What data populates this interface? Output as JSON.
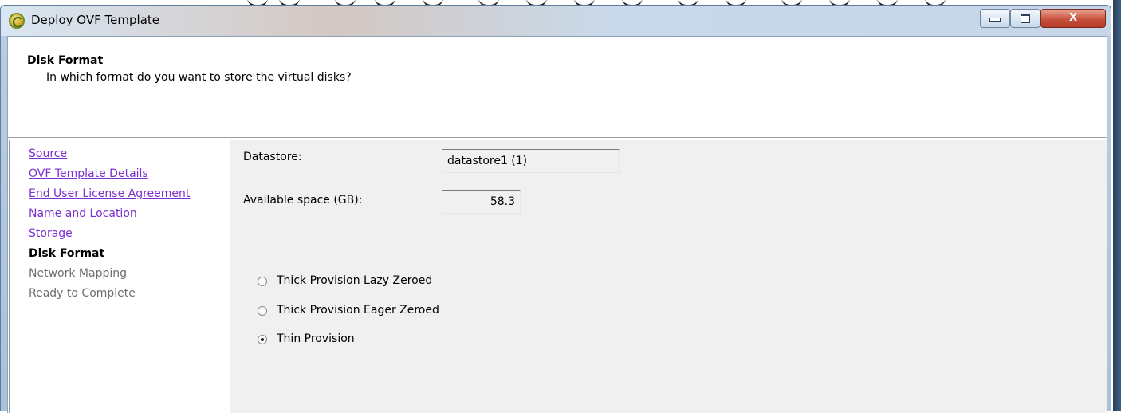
{
  "window": {
    "title": "Deploy OVF Template",
    "close_label": "X"
  },
  "header": {
    "title": "Disk Format",
    "description": "In which format do you want to store the virtual disks?"
  },
  "steps": [
    {
      "label": "Source",
      "state": "completed"
    },
    {
      "label": "OVF Template Details",
      "state": "completed"
    },
    {
      "label": "End User License Agreement",
      "state": "completed"
    },
    {
      "label": "Name and Location",
      "state": "completed"
    },
    {
      "label": "Storage",
      "state": "completed"
    },
    {
      "label": "Disk Format",
      "state": "current"
    },
    {
      "label": "Network Mapping",
      "state": "future"
    },
    {
      "label": "Ready to Complete",
      "state": "future"
    }
  ],
  "form": {
    "datastore_label": "Datastore:",
    "datastore_value": "datastore1 (1)",
    "space_label": "Available space (GB):",
    "space_value": "58.3",
    "options": [
      {
        "label": "Thick Provision Lazy Zeroed",
        "selected": false
      },
      {
        "label": "Thick Provision Eager Zeroed",
        "selected": false
      },
      {
        "label": "Thin Provision",
        "selected": true
      }
    ]
  },
  "colors": {
    "link": "#7a2fd0",
    "close_button": "#c8513d",
    "panel_background": "#f0f0f0"
  }
}
